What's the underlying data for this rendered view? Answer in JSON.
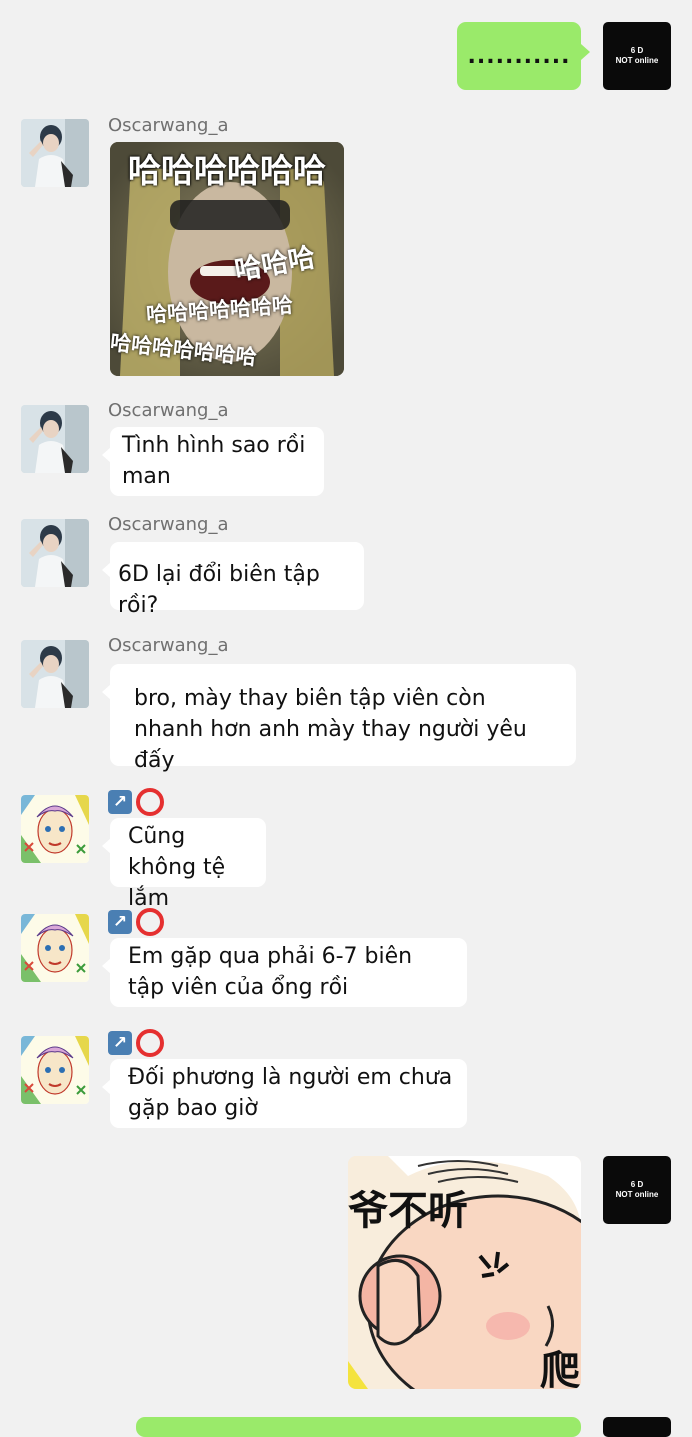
{
  "self": {
    "avatar_text_line1": "6 D",
    "avatar_text_line2": "NOT online"
  },
  "messages": [
    {
      "sender": "self",
      "type": "text",
      "text": "..........."
    },
    {
      "sender": "Oscarwang_a",
      "type": "sticker",
      "sticker": "laughing-woman-sticker",
      "caption_top": "哈哈哈哈哈哈",
      "caption_mid": "哈哈哈",
      "caption_low": "哈哈哈哈哈哈哈",
      "caption_bottom": "哈哈哈哈哈哈哈"
    },
    {
      "sender": "Oscarwang_a",
      "type": "text",
      "text": "Tình hình sao rồi man"
    },
    {
      "sender": "Oscarwang_a",
      "type": "text",
      "text": "6D lại đổi biên tập rồi?"
    },
    {
      "sender": "Oscarwang_a",
      "type": "text",
      "text": "bro, mày thay biên tập viên còn nhanh hơn anh mày thay người yêu đấy"
    },
    {
      "sender": "↗️⭕",
      "type": "text",
      "text": "Cũng không tệ lắm"
    },
    {
      "sender": "↗️⭕",
      "type": "text",
      "text": "Em gặp qua phải 6-7 biên tập viên của ổng rồi"
    },
    {
      "sender": "↗️⭕",
      "type": "text",
      "text": "Đối phương là người em chưa gặp bao giờ"
    },
    {
      "sender": "self",
      "type": "sticker",
      "sticker": "covering-ears-cartoon-sticker",
      "caption_top": "爷不听",
      "caption_side": "爬"
    }
  ],
  "names": {
    "oscar": "Oscarwang_a"
  },
  "colors": {
    "background": "#f1f1f1",
    "self_bubble": "#9aea6a",
    "other_bubble": "#ffffff",
    "name_text": "#707070",
    "arrow_emoji": "#4a7fb3",
    "ring_emoji": "#e53030"
  }
}
